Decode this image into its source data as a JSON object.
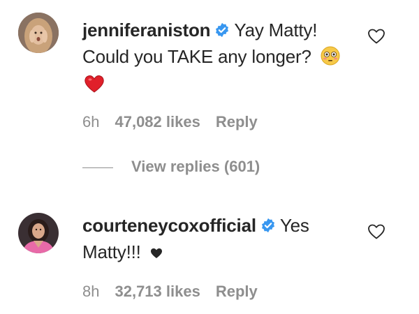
{
  "comments": [
    {
      "username": "jenniferaniston",
      "verified": true,
      "text_line1": "Yay Matty!",
      "text_line2": "Could you TAKE any longer?",
      "emoji1": "flushed-face-emoji",
      "emoji2": "red-heart-emoji",
      "time": "6h",
      "likes": "47,082 likes",
      "reply": "Reply",
      "view_replies": "View replies (601)"
    },
    {
      "username": "courteneycoxofficial",
      "verified": true,
      "text_line1": "Yes",
      "text_line2": "Matty!!!",
      "emoji1": "black-heart-symbol",
      "time": "8h",
      "likes": "32,713 likes",
      "reply": "Reply"
    }
  ],
  "icons": {
    "like": "heart-outline-icon",
    "verified": "verified-badge-icon"
  },
  "colors": {
    "verified_blue": "#3897f0",
    "text": "#262626",
    "muted": "#8e8e8e",
    "heart_red": "#e0202a"
  }
}
